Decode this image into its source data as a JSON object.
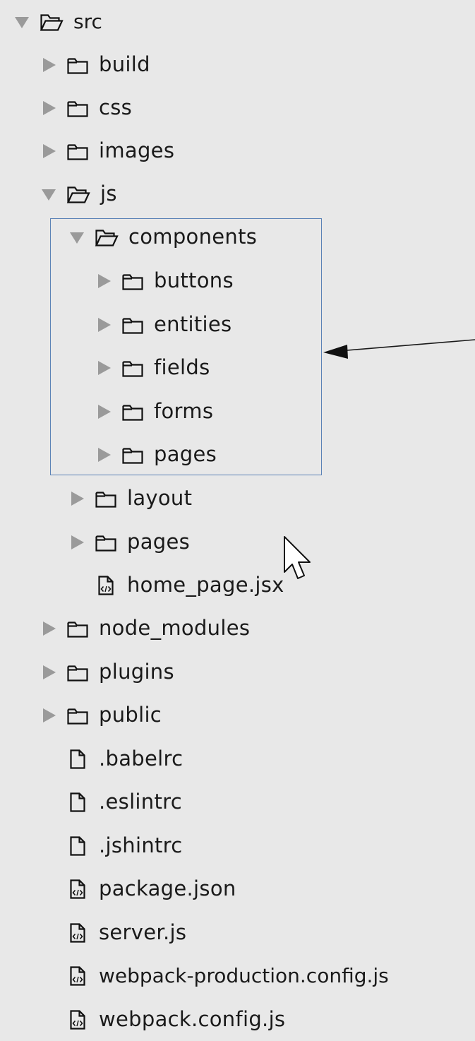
{
  "tree": {
    "root": {
      "label": "src"
    },
    "items": [
      {
        "label": "build"
      },
      {
        "label": "css"
      },
      {
        "label": "images"
      },
      {
        "label": "js"
      },
      {
        "label": "components"
      },
      {
        "label": "buttons"
      },
      {
        "label": "entities"
      },
      {
        "label": "fields"
      },
      {
        "label": "forms"
      },
      {
        "label": "pages"
      },
      {
        "label": "layout"
      },
      {
        "label": "pages"
      },
      {
        "label": "home_page.jsx"
      },
      {
        "label": "node_modules"
      },
      {
        "label": "plugins"
      },
      {
        "label": "public"
      },
      {
        "label": ".babelrc"
      },
      {
        "label": ".eslintrc"
      },
      {
        "label": ".jshintrc"
      },
      {
        "label": "package.json"
      },
      {
        "label": "server.js"
      },
      {
        "label": "webpack-production.config.js"
      },
      {
        "label": "webpack.config.js"
      }
    ]
  },
  "icons": {
    "expanded": "chevron-down-icon",
    "collapsed": "chevron-right-icon",
    "folder_closed": "folder-icon",
    "folder_open": "folder-open-icon",
    "file_plain": "file-icon",
    "file_code": "code-file-icon",
    "pointer": "mouse-pointer-icon"
  },
  "colors": {
    "background": "#e8e8e8",
    "text": "#1a1a1a",
    "chevron": "#9a9a9a",
    "highlight_border": "#5b82b6"
  }
}
